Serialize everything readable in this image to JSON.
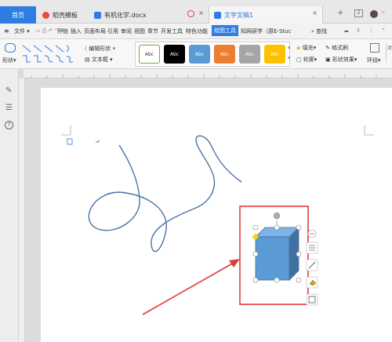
{
  "tabs": {
    "home": "首页",
    "template": "稻壳模板",
    "doc": "有机化学.docx",
    "active": "文字文稿1",
    "count": "2"
  },
  "menus": {
    "file": "文件",
    "items": [
      "开始",
      "插入",
      "页面布局",
      "引用",
      "审阅",
      "视图",
      "章节",
      "开发工具",
      "特色功能",
      "绘图工具",
      "知网研学（原E-Stuc"
    ],
    "active": "绘图工具",
    "search": "查找"
  },
  "ribbon": {
    "shape": "形状",
    "edit_shape": "编辑形状",
    "textbox": "文本框",
    "styles": [
      "Abc",
      "Abc",
      "Abc",
      "Abc",
      "Abc",
      "Abc"
    ],
    "fill": "填充",
    "format_brush": "格式刷",
    "outline": "轮廓",
    "shape_effects": "形状效果",
    "wrap": "环绕"
  },
  "colors": {
    "accent": "#2f7de1",
    "style_fills": [
      "#ffffff",
      "#000000",
      "#5b9bd5",
      "#ed7d31",
      "#a5a5a5",
      "#ffc000"
    ],
    "cube_front": "#5b9bd5",
    "cube_top": "#7fb2e5",
    "cube_side": "#41729f",
    "highlight": "#e23b3b"
  },
  "icons": {
    "pen": "pen-icon",
    "sliders": "sliders-icon",
    "help": "help-icon",
    "search": "search-icon",
    "share": "share-icon",
    "cloud": "cloud-icon",
    "collapse": "chevron-up-icon"
  }
}
